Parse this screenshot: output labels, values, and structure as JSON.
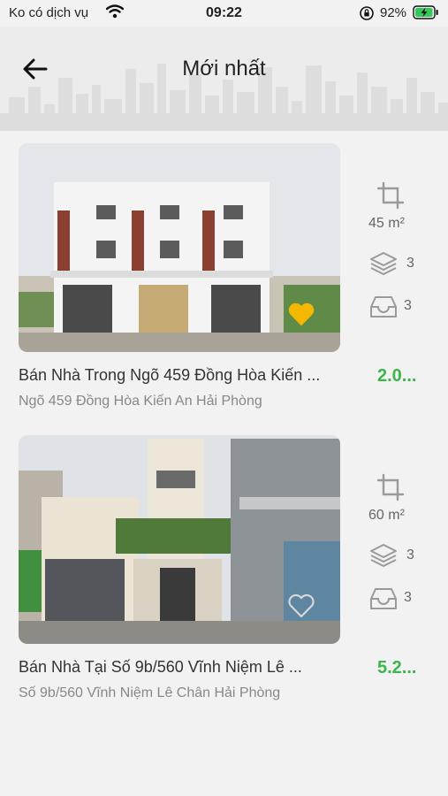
{
  "status": {
    "carrier": "Ko có dịch vụ",
    "time": "09:22",
    "battery": "92%"
  },
  "header": {
    "title": "Mới nhất"
  },
  "listings": [
    {
      "title": "Bán Nhà Trong Ngõ 459 Đồng Hòa Kiến ...",
      "price": "2.0...",
      "address": "Ngõ 459 Đồng Hòa Kiến An Hải Phòng",
      "area": "45 m²",
      "floors": "3",
      "bedrooms": "3",
      "favorited": true
    },
    {
      "title": "Bán Nhà Tại Số 9b/560 Vĩnh Niệm Lê ...",
      "price": "5.2...",
      "address": "Số 9b/560 Vĩnh Niệm Lê Chân Hải Phòng",
      "area": "60 m²",
      "floors": "3",
      "bedrooms": "3",
      "favorited": false
    }
  ],
  "colors": {
    "price": "#3cb54a",
    "favorite": "#f5b800",
    "icon": "#9a9a9a"
  }
}
